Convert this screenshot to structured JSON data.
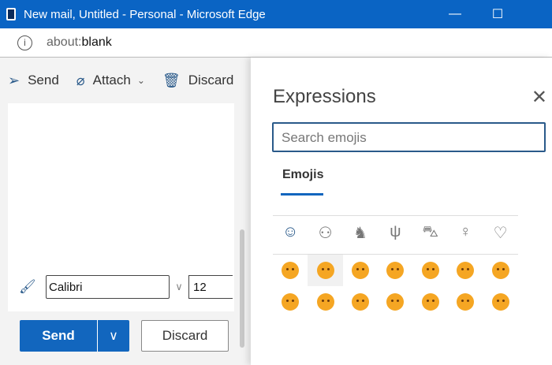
{
  "window": {
    "title": "New mail, Untitled - Personal - Microsoft Edge",
    "minimize": "—",
    "maximize": "☐"
  },
  "address": {
    "prefix": "about:",
    "value": "blank",
    "info_icon": "i"
  },
  "toolbar": {
    "send": "Send",
    "attach": "Attach",
    "discard": "Discard"
  },
  "format": {
    "font": "Calibri",
    "size": "12"
  },
  "actions": {
    "send": "Send",
    "discard": "Discard"
  },
  "panel": {
    "title": "Expressions",
    "close": "✕",
    "search_placeholder": "Search emojis",
    "tab": "Emojis",
    "categories": [
      "smileys",
      "people",
      "animals",
      "food",
      "travel",
      "objects",
      "symbols"
    ],
    "emojis": [
      "smiling-face-with-smiling-eyes",
      "face-savoring-food",
      "relieved-face",
      "smiling-face-with-heart-eyes",
      "face-blowing-kiss",
      "kissing-face",
      "kissing-face-with-smiling-eyes",
      "kissing-face-with-closed-eyes",
      "winking-face-with-tongue",
      "zany-face",
      "face-with-raised-eyebrow",
      "face-with-monocle",
      "squinting-face-with-tongue",
      "money-mouth-face"
    ]
  }
}
